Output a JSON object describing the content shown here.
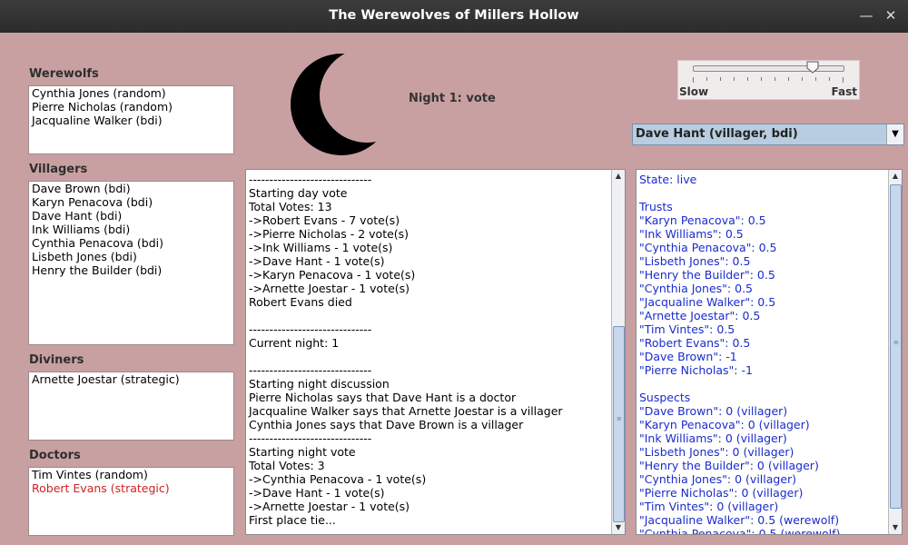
{
  "window": {
    "title": "The Werewolves of Millers Hollow"
  },
  "groups": {
    "werewolfs": {
      "label": "Werewolfs",
      "items": [
        {
          "text": "Cynthia Jones (random)"
        },
        {
          "text": "Pierre Nicholas (random)"
        },
        {
          "text": "Jacqualine Walker (bdi)"
        }
      ]
    },
    "villagers": {
      "label": "Villagers",
      "items": [
        {
          "text": "Dave Brown (bdi)"
        },
        {
          "text": "Karyn Penacova (bdi)"
        },
        {
          "text": "Dave Hant (bdi)"
        },
        {
          "text": "Ink Williams (bdi)"
        },
        {
          "text": "Cynthia Penacova (bdi)"
        },
        {
          "text": "Lisbeth Jones (bdi)"
        },
        {
          "text": "Henry the Builder (bdi)"
        }
      ]
    },
    "diviners": {
      "label": "Diviners",
      "items": [
        {
          "text": "Arnette Joestar (strategic)"
        }
      ]
    },
    "doctors": {
      "label": "Doctors",
      "items": [
        {
          "text": "Tim Vintes (random)"
        },
        {
          "text": "Robert Evans (strategic)",
          "dead": true
        }
      ]
    }
  },
  "phase": {
    "label": "Night 1: vote",
    "icon": "crescent-moon-icon"
  },
  "speed": {
    "slow_label": "Slow",
    "fast_label": "Fast",
    "value_fraction": 0.8
  },
  "selected_player": "Dave Hant (villager, bdi)",
  "log_lines": [
    "------------------------------",
    "Starting day vote",
    "Total Votes: 13",
    "->Robert Evans - 7 vote(s)",
    "->Pierre Nicholas - 2 vote(s)",
    "->Ink Williams - 1 vote(s)",
    "->Dave Hant - 1 vote(s)",
    "->Karyn Penacova - 1 vote(s)",
    "->Arnette Joestar - 1 vote(s)",
    "Robert Evans died",
    "",
    "------------------------------",
    "Current night: 1",
    "",
    "------------------------------",
    "Starting night discussion",
    "Pierre Nicholas says that Dave Hant is a doctor",
    "Jacqualine Walker says that Arnette Joestar is a villager",
    "Cynthia Jones says that Dave Brown is a villager",
    "------------------------------",
    "Starting night vote",
    "Total Votes: 3",
    "->Cynthia Penacova - 1 vote(s)",
    "->Dave Hant - 1 vote(s)",
    "->Arnette Joestar - 1 vote(s)",
    "First place tie..."
  ],
  "state_lines": [
    "State: live",
    "",
    "Trusts",
    "\"Karyn Penacova\": 0.5",
    "\"Ink Williams\": 0.5",
    "\"Cynthia Penacova\": 0.5",
    "\"Lisbeth Jones\": 0.5",
    "\"Henry the Builder\": 0.5",
    "\"Cynthia Jones\": 0.5",
    "\"Jacqualine Walker\": 0.5",
    "\"Arnette Joestar\": 0.5",
    "\"Tim Vintes\": 0.5",
    "\"Robert Evans\": 0.5",
    "\"Dave Brown\": -1",
    "\"Pierre Nicholas\": -1",
    "",
    "Suspects",
    "\"Dave Brown\": 0 (villager)",
    "\"Karyn Penacova\": 0 (villager)",
    "\"Ink Williams\": 0 (villager)",
    "\"Lisbeth Jones\": 0 (villager)",
    "\"Henry the Builder\": 0 (villager)",
    "\"Cynthia Jones\": 0 (villager)",
    "\"Pierre Nicholas\": 0 (villager)",
    "\"Tim Vintes\": 0 (villager)",
    "\"Jacqualine Walker\": 0.5 (werewolf)",
    "\"Cynthia Penacova\": 0.5 (werewolf)"
  ],
  "colors": {
    "background": "#c9a0a2",
    "dead_player": "#d02020",
    "state_text": "#1a2ccc"
  }
}
